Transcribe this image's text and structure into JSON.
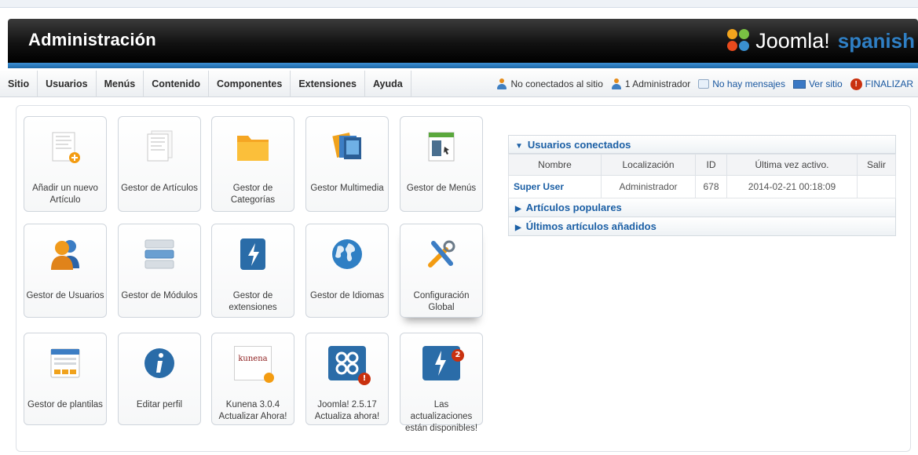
{
  "header": {
    "title": "Administración",
    "logo_word": "Joomla!",
    "logo_tag": "spanish",
    "accent_color": "#2f7fc4"
  },
  "menu": {
    "items": [
      "Sitio",
      "Usuarios",
      "Menús",
      "Contenido",
      "Componentes",
      "Extensiones",
      "Ayuda"
    ]
  },
  "status": {
    "visitors": "No conectados al sitio",
    "admins": "1 Administrador",
    "messages": "No hay mensajes",
    "view_site": "Ver sitio",
    "logout": "FINALIZAR"
  },
  "tiles": [
    {
      "label": "Añadir un nuevo Artículo",
      "icon": "add-article-icon"
    },
    {
      "label": "Gestor de Artículos",
      "icon": "article-manager-icon"
    },
    {
      "label": "Gestor de Categorías",
      "icon": "folder-icon"
    },
    {
      "label": "Gestor Multimedia",
      "icon": "media-icon"
    },
    {
      "label": "Gestor de Menús",
      "icon": "menu-manager-icon"
    },
    {
      "label": "Gestor de Usuarios",
      "icon": "users-icon"
    },
    {
      "label": "Gestor de Módulos",
      "icon": "modules-icon"
    },
    {
      "label": "Gestor de extensiones",
      "icon": "extensions-icon"
    },
    {
      "label": "Gestor de Idiomas",
      "icon": "globe-icon"
    },
    {
      "label": "Configuración Global",
      "icon": "tools-icon"
    },
    {
      "label": "Gestor de plantilas",
      "icon": "template-icon"
    },
    {
      "label": "Editar perfil",
      "icon": "info-icon"
    },
    {
      "label": "Kunena 3.0.4 Actualizar Ahora!",
      "icon": "kunena-icon"
    },
    {
      "label": "Joomla! 2.5.17 Actualiza ahora!",
      "icon": "joomla-update-icon"
    },
    {
      "label": "Las actualizaciones están disponibles!",
      "icon": "updates-icon"
    }
  ],
  "kunena_logo_text": "kunena",
  "updates_badge": "2",
  "joomla_badge": "!",
  "panel": {
    "connected_title": "Usuarios conectados",
    "columns": [
      "Nombre",
      "Localización",
      "ID",
      "Última vez activo.",
      "Salir"
    ],
    "rows": [
      {
        "name": "Super User",
        "location": "Administrador",
        "id": "678",
        "last_active": "2014-02-21 00:18:09",
        "logout": ""
      }
    ],
    "popular_title": "Artículos populares",
    "latest_title": "Últimos artículos añadidos"
  }
}
